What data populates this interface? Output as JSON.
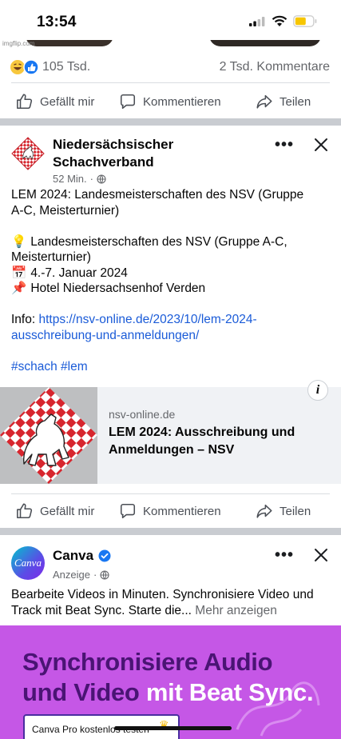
{
  "status_bar": {
    "time": "13:54"
  },
  "previous_post": {
    "watermark": "imgflip.com",
    "reaction_count": "105 Tsd.",
    "comment_count": "2 Tsd. Kommentare",
    "actions": {
      "like": "Gefällt mir",
      "comment": "Kommentieren",
      "share": "Teilen"
    }
  },
  "post": {
    "page_name": "Niedersächsischer Schachverband",
    "time": "52 Min.",
    "dot": "·",
    "text_lines": [
      "LEM 2024: Landesmeisterschaften des NSV (Gruppe",
      "A-C, Meisterturnier)"
    ],
    "bullet_1_emoji": "💡",
    "bullet_1_line1": " Landesmeisterschaften des NSV (Gruppe A-C,",
    "bullet_1_line2": "Meisterturnier)",
    "bullet_2_emoji": "📅",
    "bullet_2": "4.-7. Januar 2024",
    "bullet_3_emoji": "📌",
    "bullet_3": "Hotel Niedersachsenhof Verden",
    "info_label": "Info: ",
    "info_link_1": "https://nsv-online.de/2023/10/lem-2024-",
    "info_link_2": "ausschreibung-und-anmeldungen/",
    "hashtags": "#schach #lem",
    "link_preview": {
      "domain": "nsv-online.de",
      "title": "LEM 2024: Ausschreibung und Anmeldungen – NSV",
      "info_icon": "i"
    },
    "actions": {
      "like": "Gefällt mir",
      "comment": "Kommentieren",
      "share": "Teilen"
    }
  },
  "ad": {
    "avatar_text": "Canva",
    "page_name": "Canva",
    "label": "Anzeige",
    "dot": "·",
    "text": "Bearbeite Videos in Minuten. Synchronisiere Video und Track mit Beat Sync. Starte die...",
    "more": "Mehr anzeigen",
    "banner_headline_1": "Synchronisiere Audio",
    "banner_headline_2a": "und Video ",
    "banner_headline_2b": "mit Beat Sync.",
    "cta": "Canva Pro kostenlos testen"
  },
  "colors": {
    "link": "#1a5bd8",
    "muted": "#65676b",
    "banner": "#c557e6",
    "banner_text": "#4a1474",
    "nsv_red": "#d7262e"
  },
  "icons": [
    "thumbs-up-icon",
    "comment-icon",
    "share-icon",
    "more-icon",
    "close-icon",
    "globe-icon",
    "verified-icon",
    "info-icon",
    "crown-icon"
  ]
}
